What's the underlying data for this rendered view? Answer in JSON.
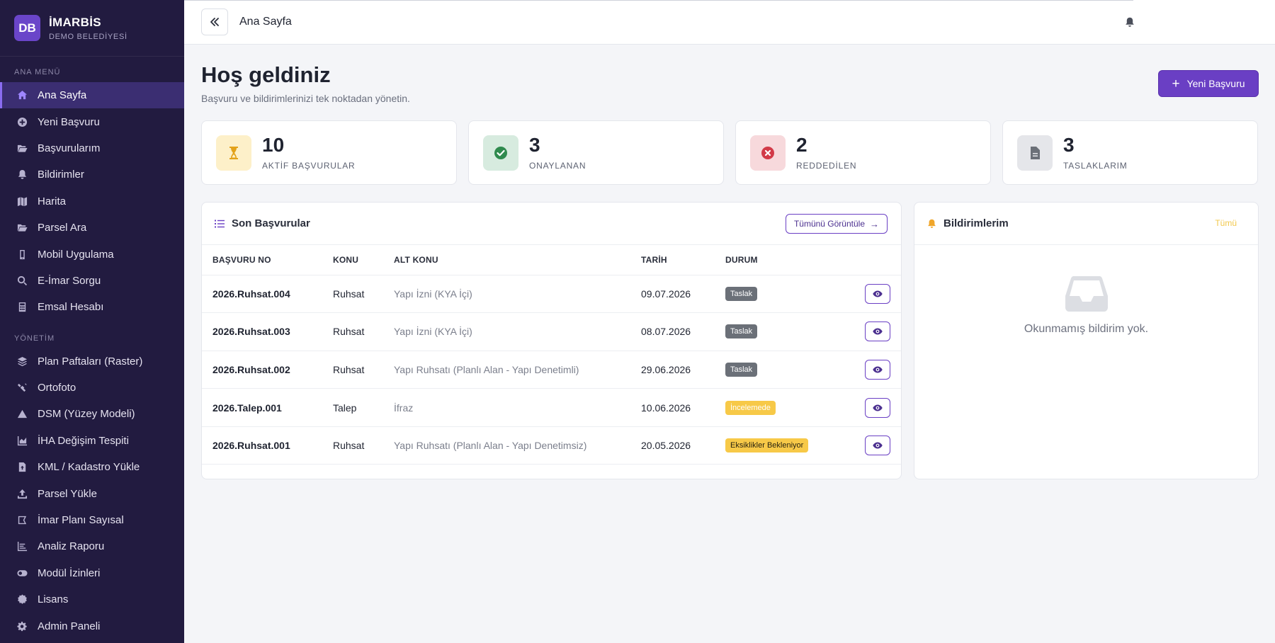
{
  "brand": {
    "logo": "DB",
    "name": "İMARBİS",
    "subtitle": "DEMO BELEDİYESİ"
  },
  "sidebar": {
    "section_main": "ANA MENÜ",
    "main_items": [
      {
        "label": "Ana Sayfa",
        "icon": "home-icon"
      },
      {
        "label": "Yeni Başvuru",
        "icon": "plus-circle-icon"
      },
      {
        "label": "Başvurularım",
        "icon": "folder-open-icon"
      },
      {
        "label": "Bildirimler",
        "icon": "bell-icon"
      },
      {
        "label": "Harita",
        "icon": "map-icon"
      },
      {
        "label": "Parsel Ara",
        "icon": "folder-open-icon"
      },
      {
        "label": "Mobil Uygulama",
        "icon": "mobile-icon"
      },
      {
        "label": "E-İmar Sorgu",
        "icon": "search-icon"
      },
      {
        "label": "Emsal Hesabı",
        "icon": "calculator-icon"
      }
    ],
    "section_admin": "YÖNETİM",
    "admin_items": [
      {
        "label": "Plan Paftaları (Raster)",
        "icon": "layers-icon"
      },
      {
        "label": "Ortofoto",
        "icon": "satellite-icon"
      },
      {
        "label": "DSM (Yüzey Modeli)",
        "icon": "mountain-icon"
      },
      {
        "label": "İHA Değişim Tespiti",
        "icon": "chart-area-icon"
      },
      {
        "label": "KML / Kadastro Yükle",
        "icon": "file-upload-icon"
      },
      {
        "label": "Parsel Yükle",
        "icon": "upload-icon"
      },
      {
        "label": "İmar Planı Sayısal",
        "icon": "draw-polygon-icon"
      },
      {
        "label": "Analiz Raporu",
        "icon": "chart-line-icon"
      },
      {
        "label": "Modül İzinleri",
        "icon": "toggle-icon"
      },
      {
        "label": "Lisans",
        "icon": "certificate-icon"
      },
      {
        "label": "Admin Paneli",
        "icon": "gear-icon"
      }
    ]
  },
  "topbar": {
    "title": "Ana Sayfa"
  },
  "welcome": {
    "title": "Hoş geldiniz",
    "subtitle": "Başvuru ve bildirimlerinizi tek noktadan yönetin.",
    "new_button": "Yeni Başvuru"
  },
  "stats": [
    {
      "value": "10",
      "label": "AKTİF BAŞVURULAR",
      "icon": "hourglass-icon",
      "bg": "#fdf0c9",
      "fg": "#e3a21a"
    },
    {
      "value": "3",
      "label": "ONAYLANAN",
      "icon": "check-circle-icon",
      "bg": "#d7ebdf",
      "fg": "#2f8a4e"
    },
    {
      "value": "2",
      "label": "REDDEDİLEN",
      "icon": "x-circle-icon",
      "bg": "#f7d9dc",
      "fg": "#d23a48"
    },
    {
      "value": "3",
      "label": "TASLAKLARIM",
      "icon": "file-icon",
      "bg": "#e5e6ea",
      "fg": "#6b7078"
    }
  ],
  "recent": {
    "title": "Son Başvurular",
    "view_all": "Tümünü Görüntüle",
    "columns": [
      "BAŞVURU NO",
      "KONU",
      "ALT KONU",
      "TARİH",
      "DURUM"
    ],
    "rows": [
      {
        "no": "2026.Ruhsat.004",
        "konu": "Ruhsat",
        "alt": "Yapı İzni (KYA İçi)",
        "tarih": "09.07.2026",
        "durum": "Taslak",
        "kind": "taslak"
      },
      {
        "no": "2026.Ruhsat.003",
        "konu": "Ruhsat",
        "alt": "Yapı İzni (KYA İçi)",
        "tarih": "08.07.2026",
        "durum": "Taslak",
        "kind": "taslak"
      },
      {
        "no": "2026.Ruhsat.002",
        "konu": "Ruhsat",
        "alt": "Yapı Ruhsatı (Planlı Alan - Yapı Denetimli)",
        "tarih": "29.06.2026",
        "durum": "Taslak",
        "kind": "taslak"
      },
      {
        "no": "2026.Talep.001",
        "konu": "Talep",
        "alt": "İfraz",
        "tarih": "10.06.2026",
        "durum": "İncelemede",
        "kind": "inceleme"
      },
      {
        "no": "2026.Ruhsat.001",
        "konu": "Ruhsat",
        "alt": "Yapı Ruhsatı (Planlı Alan - Yapı Denetimsiz)",
        "tarih": "20.05.2026",
        "durum": "Eksiklikler Bekleniyor",
        "kind": "eksik"
      }
    ]
  },
  "notifications": {
    "title": "Bildirimlerim",
    "all_link": "Tümü",
    "empty_text": "Okunmamış bildirim yok."
  },
  "colors": {
    "sidebar_bg": "#221b40",
    "accent": "#6a3fc4",
    "warning": "#f7c948"
  }
}
